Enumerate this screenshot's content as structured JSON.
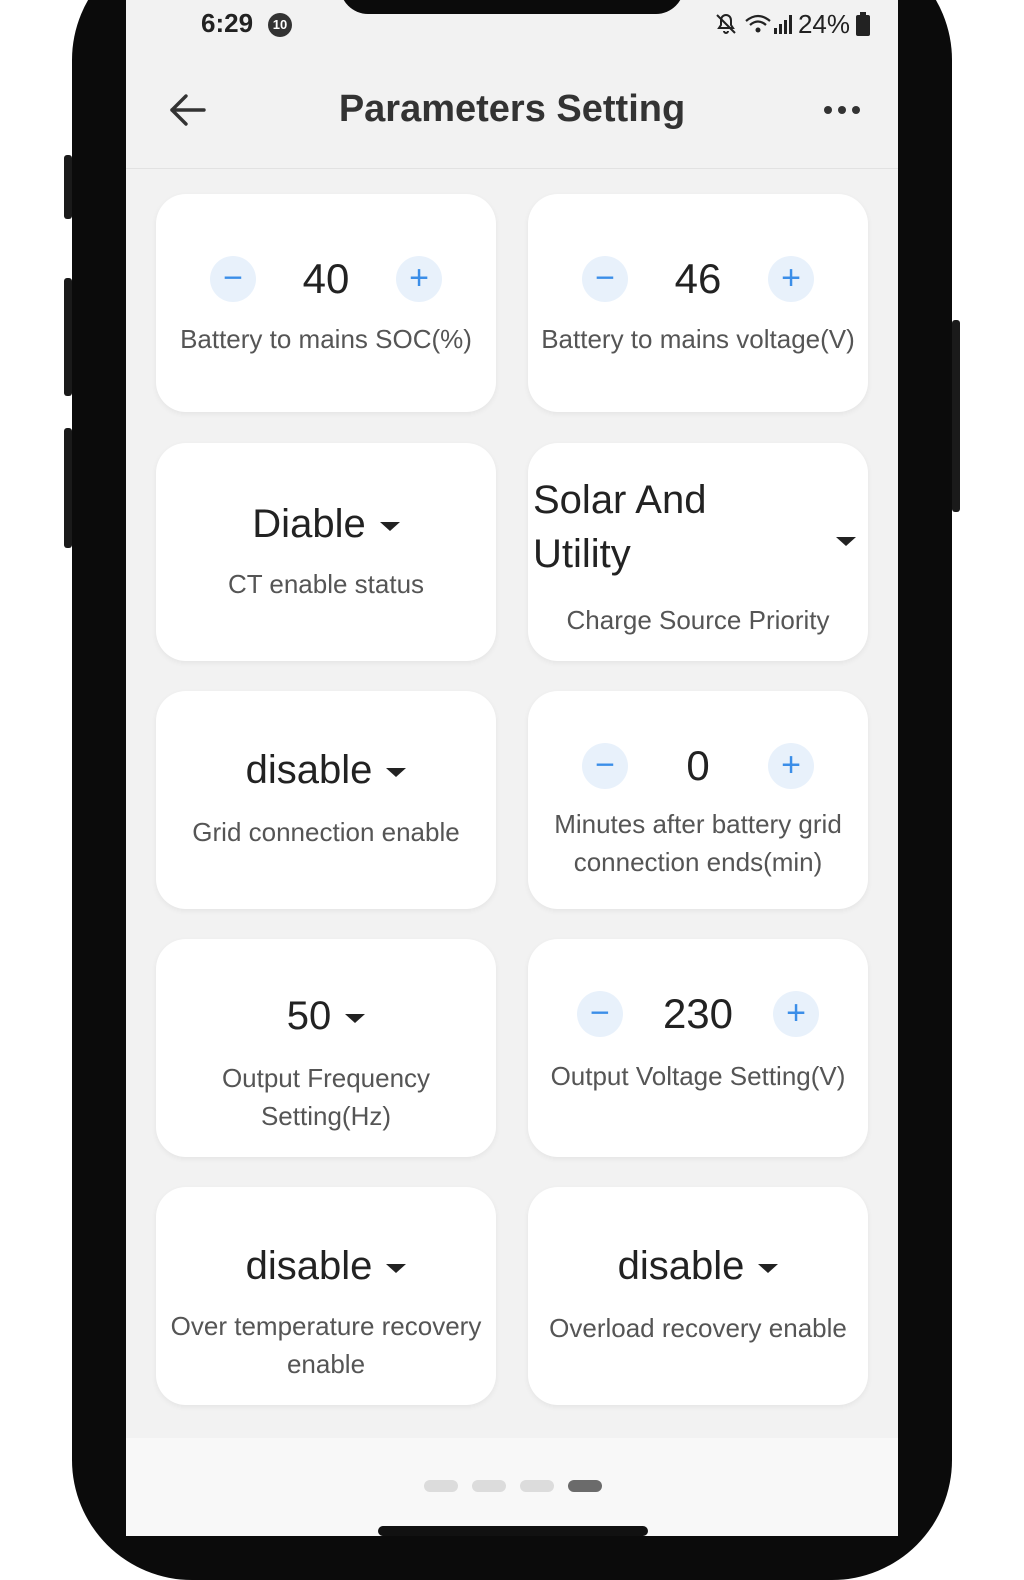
{
  "status_bar": {
    "time": "6:29",
    "notification_count": "10",
    "battery": "24%"
  },
  "header": {
    "title": "Parameters Setting"
  },
  "cards": {
    "battery_soc": {
      "value": "40",
      "label": "Battery to mains SOC(%)"
    },
    "battery_voltage": {
      "value": "46",
      "label": "Battery to mains voltage(V)"
    },
    "ct_enable": {
      "value": "Diable",
      "label": "CT enable status"
    },
    "charge_priority": {
      "value": "Solar And Utility",
      "label": "Charge Source Priority"
    },
    "grid_connection": {
      "value": "disable",
      "label": "Grid connection enable"
    },
    "minutes_after": {
      "value": "0",
      "label": "Minutes after  battery grid connection ends(min)"
    },
    "output_frequency": {
      "value": "50",
      "label": "Output Frequency Setting(Hz)"
    },
    "output_voltage": {
      "value": "230",
      "label": "Output Voltage Setting(V)"
    },
    "over_temp_recovery": {
      "value": "disable",
      "label": "Over temperature recovery enable"
    },
    "overload_recovery": {
      "value": "disable",
      "label": "Overload recovery enable"
    }
  },
  "pagination": {
    "total": 4,
    "active_index": 3
  },
  "colors": {
    "accent": "#3b8ee8",
    "stepper_bg": "#e8f1fb",
    "background": "#f2f2f2"
  }
}
